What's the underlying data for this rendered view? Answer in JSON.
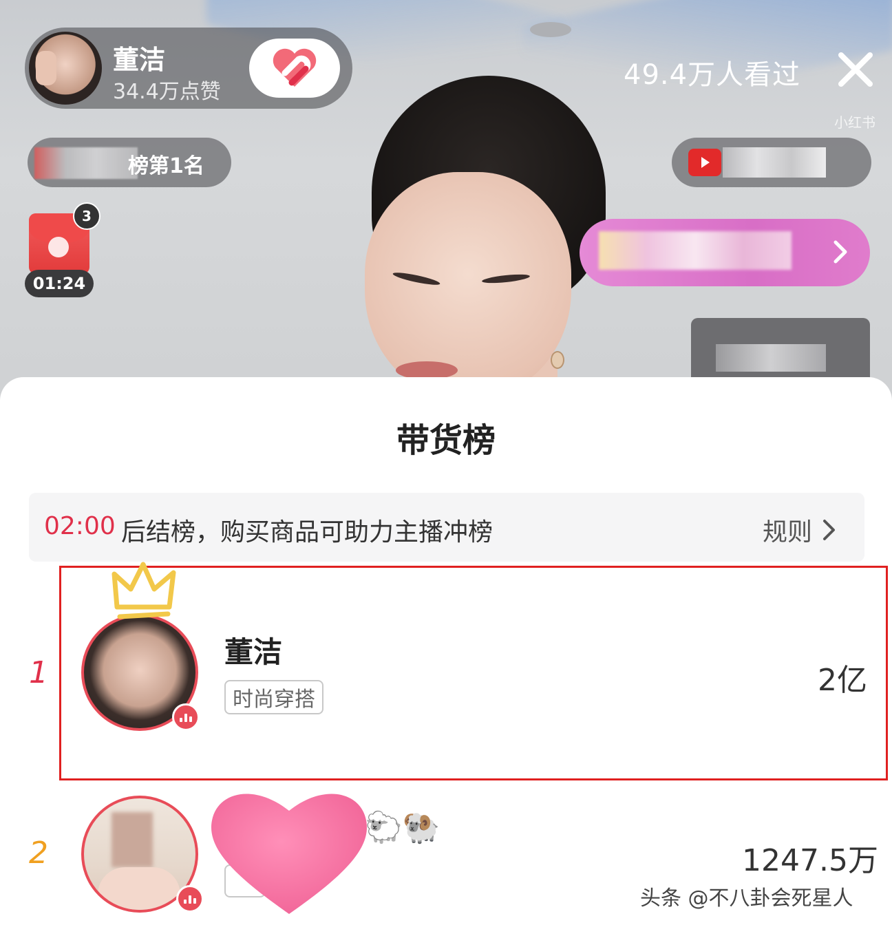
{
  "live": {
    "host": {
      "name": "董洁",
      "likes": "34.4万点赞"
    },
    "viewers": "49.4万人看过",
    "rank_badge": "榜第1名",
    "red_packet": {
      "count": "3",
      "timer": "01:24"
    },
    "corner_watermark": "小红书"
  },
  "leaderboard": {
    "title": "带货榜",
    "countdown": "02:00",
    "notice": "后结榜，购买商品可助力主播冲榜",
    "rules_label": "规则",
    "rows": [
      {
        "rank": "1",
        "name": "董洁",
        "tag": "时尚穿搭",
        "value": "2亿",
        "rank_color": "#e0304a"
      },
      {
        "rank": "2",
        "name": "🐑🐏",
        "value": "1247.5万",
        "rank_color": "#f0a020"
      }
    ]
  },
  "footer": {
    "watermark": "头条 @不八卦会死星人"
  },
  "icons": {
    "follow": "heart-link-icon",
    "close": "close-icon",
    "rules_arrow": "chevron-right-icon",
    "product_arrow": "chevron-right-icon",
    "crown": "crown-icon",
    "live_status": "live-bars-icon"
  },
  "colors": {
    "accent_red": "#e84c58",
    "highlight_border": "#e02020",
    "product_pill": "#d86ec6"
  }
}
